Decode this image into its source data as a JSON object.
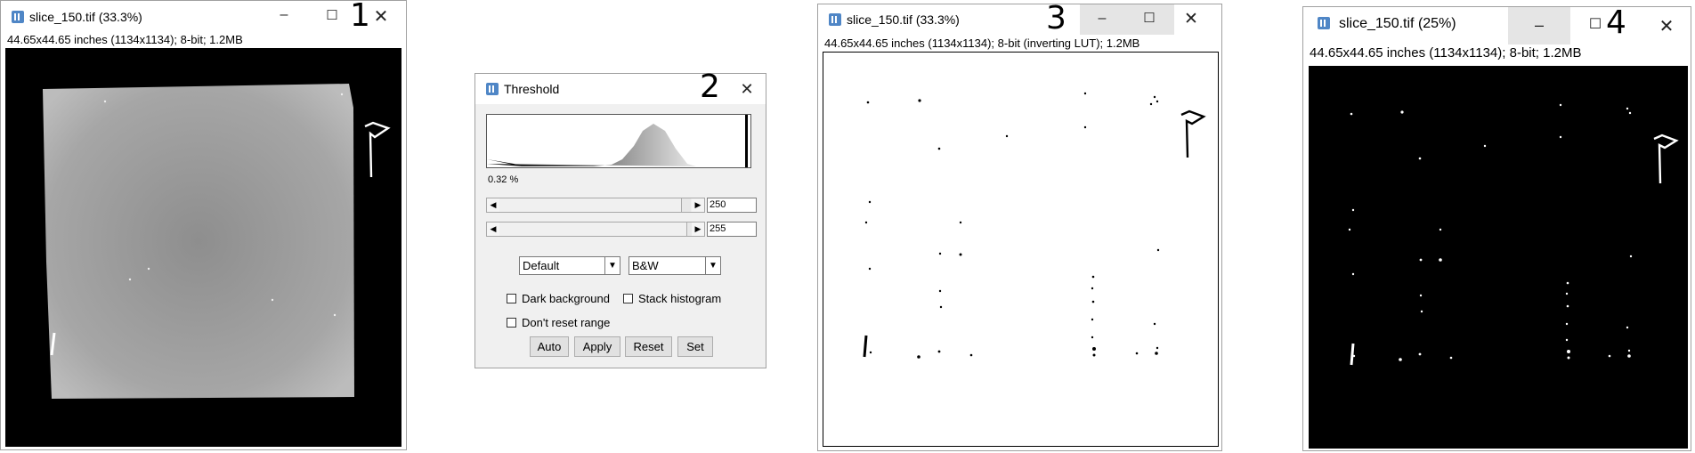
{
  "window1": {
    "title": "slice_150.tif (33.3%)",
    "badge": "1",
    "info": "44.65x44.65 inches (1134x1134); 8-bit; 1.2MB",
    "minimize_icon": "minimize-icon",
    "maximize_icon": "maximize-icon",
    "close_icon": "close-icon"
  },
  "threshold": {
    "title": "Threshold",
    "badge": "2",
    "percent": "0.32 %",
    "min_value": "250",
    "max_value": "255",
    "method": "Default",
    "display": "B&W",
    "checkboxes": {
      "dark_background": "Dark background",
      "stack_histogram": "Stack histogram",
      "dont_reset_range": "Don't reset range"
    },
    "buttons": {
      "auto": "Auto",
      "apply": "Apply",
      "reset": "Reset",
      "set": "Set"
    }
  },
  "window3": {
    "title": "slice_150.tif (33.3%)",
    "badge": "3",
    "info": "44.65x44.65 inches (1134x1134); 8-bit (inverting LUT); 1.2MB"
  },
  "window4": {
    "title": "slice_150.tif (25%)",
    "badge": "4",
    "info": "44.65x44.65 inches (1134x1134); 8-bit; 1.2MB"
  },
  "colors": {
    "imagej_icon": "#4f86c6",
    "active_control_bg": "#e5e5e5"
  }
}
